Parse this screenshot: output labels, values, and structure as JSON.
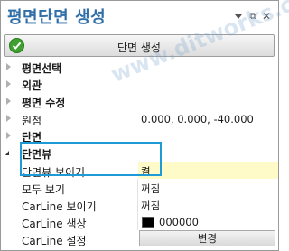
{
  "panel": {
    "title": "평면단면 생성",
    "pin_glyph": "▾",
    "float_glyph": "⧉",
    "close_glyph": "✕"
  },
  "create_button": {
    "label": "단면 생성",
    "accent": "#3fa12f"
  },
  "categories": {
    "plan_select": "평면선택",
    "exterior": "외관",
    "plan_edit": "평면 수정",
    "origin": "원점",
    "section": "단면",
    "section_view": "단면뷰"
  },
  "properties": {
    "origin_value": "0.000, 0.000, -40.000",
    "section_view_show": {
      "name": "단면뷰 보이기",
      "value": "켬"
    },
    "show_all": {
      "name": "모두 보기",
      "value": "꺼짐"
    },
    "carline_show": {
      "name": "CarLine 보이기",
      "value": "꺼짐"
    },
    "carline_color": {
      "name": "CarLine 색상",
      "value": "000000",
      "swatch": "#000000"
    },
    "carline_settings": {
      "name": "CarLine 설정",
      "button": "변경"
    }
  },
  "watermark": "www.ditworks.com",
  "highlight_color": "#1e9bd7"
}
